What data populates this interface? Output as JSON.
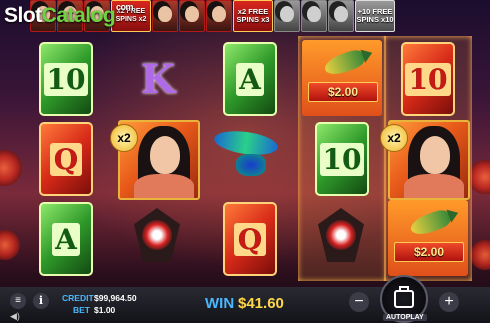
{
  "logo": {
    "part1": "Slot",
    "part2": "Catalog",
    "suffix": "com"
  },
  "top_strip": {
    "tag1": "x2 FREE SPINS x2",
    "tag2": "x2 FREE SPINS x3",
    "tag3": "+10 FREE SPINS x10"
  },
  "symbols": {
    "col1": [
      "10",
      "Q",
      "A"
    ],
    "col2": [
      "K",
      "",
      ""
    ],
    "col3": [
      "A",
      "",
      "Q"
    ],
    "col4": [
      "",
      "10",
      ""
    ],
    "col5": [
      "10",
      "",
      ""
    ]
  },
  "multiplier_badges": [
    "x2",
    "x2"
  ],
  "scroll_values": [
    "$2.00",
    "$2.00"
  ],
  "bottom_bar": {
    "menu_icon": "≡",
    "info_icon": "i",
    "sound_icon": "◀)",
    "credit_label": "CREDIT",
    "credit_value": "$99,964.50",
    "bet_label": "BET",
    "bet_value": "$1.00",
    "win_label": "WIN",
    "win_value": "$41.60",
    "minus": "−",
    "plus": "+",
    "autoplay": "AUTOPLAY"
  },
  "colors": {
    "win_value": "#ffd84a",
    "label_blue": "#4ab8ff",
    "slot_green": "#6fd341"
  }
}
